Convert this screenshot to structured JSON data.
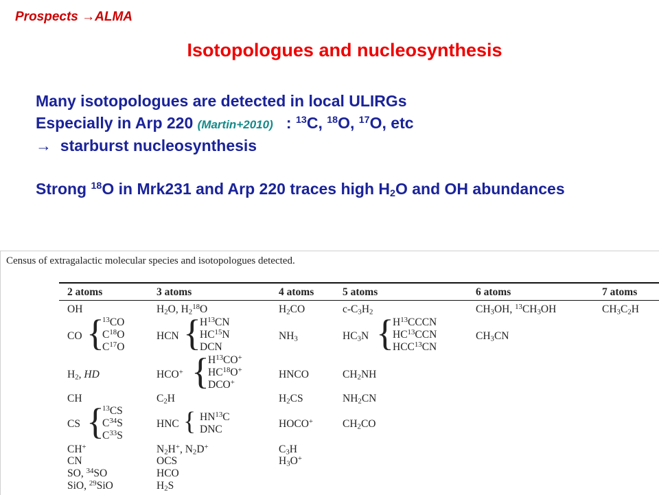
{
  "header": {
    "prefix": "Prospects ",
    "arrow": "→",
    "target": "ALMA"
  },
  "title": "Isotopologues and nucleosynthesis",
  "bullets": {
    "line1": "Many isotopologues are detected in local ULIRGs",
    "line2_a": "Especially in Arp 220 ",
    "line2_cite": "(Martin+2010)",
    "line2_b": "   : ",
    "c13": "13",
    "c_label": "C, ",
    "o18": "18",
    "o18_label": "O, ",
    "o17": "17",
    "o17_label": "O, etc",
    "line3_arrow": "→",
    "line3": "  starburst nucleosynthesis",
    "line4_a": "Strong ",
    "line4_sup": "18",
    "line4_b": "O in Mrk231 and Arp 220 traces high H",
    "line4_sub": "2",
    "line4_c": "O and OH abundances"
  },
  "table": {
    "caption": "Census of extragalactic molecular species and isotopologues detected.",
    "headers": [
      "2 atoms",
      "3 atoms",
      "4 atoms",
      "5 atoms",
      "6 atoms",
      "7 atoms"
    ]
  }
}
